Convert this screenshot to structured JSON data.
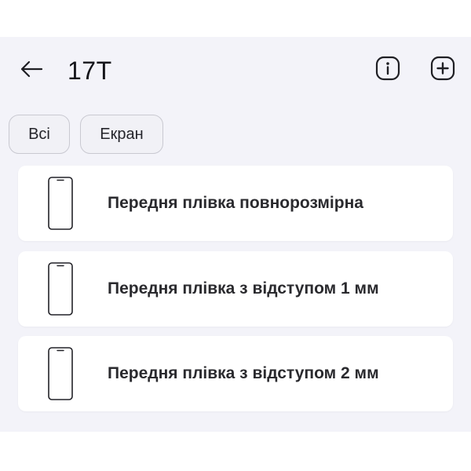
{
  "header": {
    "title": "17T",
    "back_icon": "arrow-left-icon",
    "info_icon": "info-icon",
    "add_icon": "plus-square-icon"
  },
  "filters": {
    "chips": [
      {
        "label": "Всі"
      },
      {
        "label": "Екран"
      }
    ]
  },
  "list": {
    "items": [
      {
        "label": "Передня плівка повнорозмірна",
        "icon": "phone-outline-icon"
      },
      {
        "label": "Передня плівка з відступом 1 мм",
        "icon": "phone-outline-icon"
      },
      {
        "label": "Передня плівка з відступом 2 мм",
        "icon": "phone-outline-icon"
      }
    ]
  },
  "colors": {
    "background": "#f3f3f9",
    "card": "#ffffff",
    "text": "#1c1c22",
    "chip_border": "#c9c9d1"
  }
}
